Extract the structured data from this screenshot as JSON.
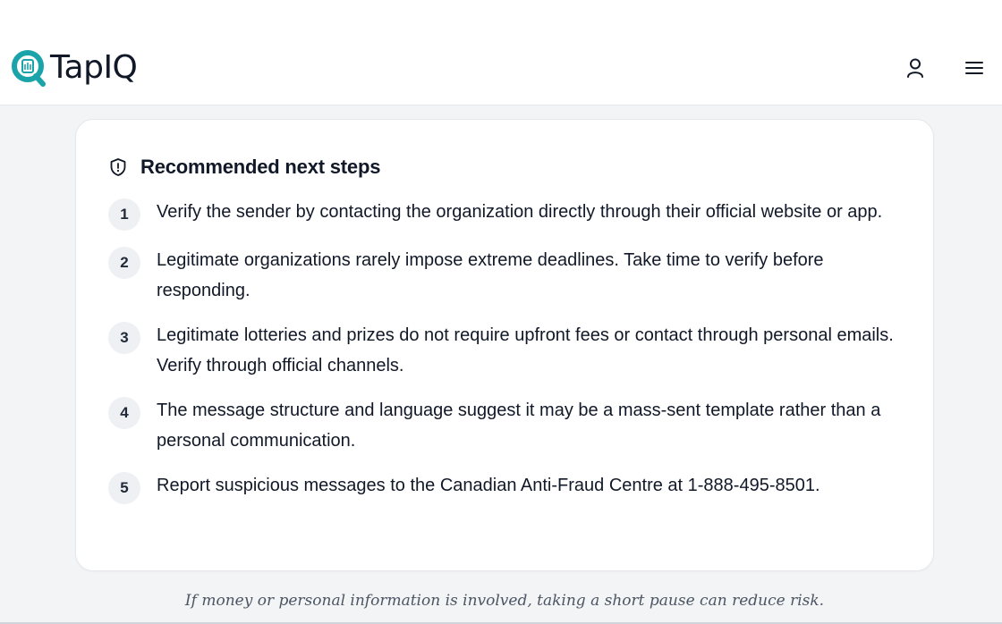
{
  "header": {
    "brand": "TapIQ",
    "logo_icon": "magnifier-logo-icon",
    "user_icon": "user-icon",
    "menu_icon": "hamburger-menu-icon",
    "accent": "#1aa3a8"
  },
  "card": {
    "title": "Recommended next steps",
    "title_icon": "shield-alert-icon",
    "steps": [
      {
        "number": "1",
        "text": "Verify the sender by contacting the organization directly through their official website or app."
      },
      {
        "number": "2",
        "text": "Legitimate organizations rarely impose extreme deadlines. Take time to verify before responding."
      },
      {
        "number": "3",
        "text": "Legitimate lotteries and prizes do not require upfront fees or contact through personal emails. Verify through official channels."
      },
      {
        "number": "4",
        "text": "The message structure and language suggest it may be a mass-sent template rather than a personal communication."
      },
      {
        "number": "5",
        "text": "Report suspicious messages to the Canadian Anti-Fraud Centre at 1-888-495-8501."
      }
    ]
  },
  "footnote": "If money or personal information is involved, taking a short pause can reduce risk."
}
